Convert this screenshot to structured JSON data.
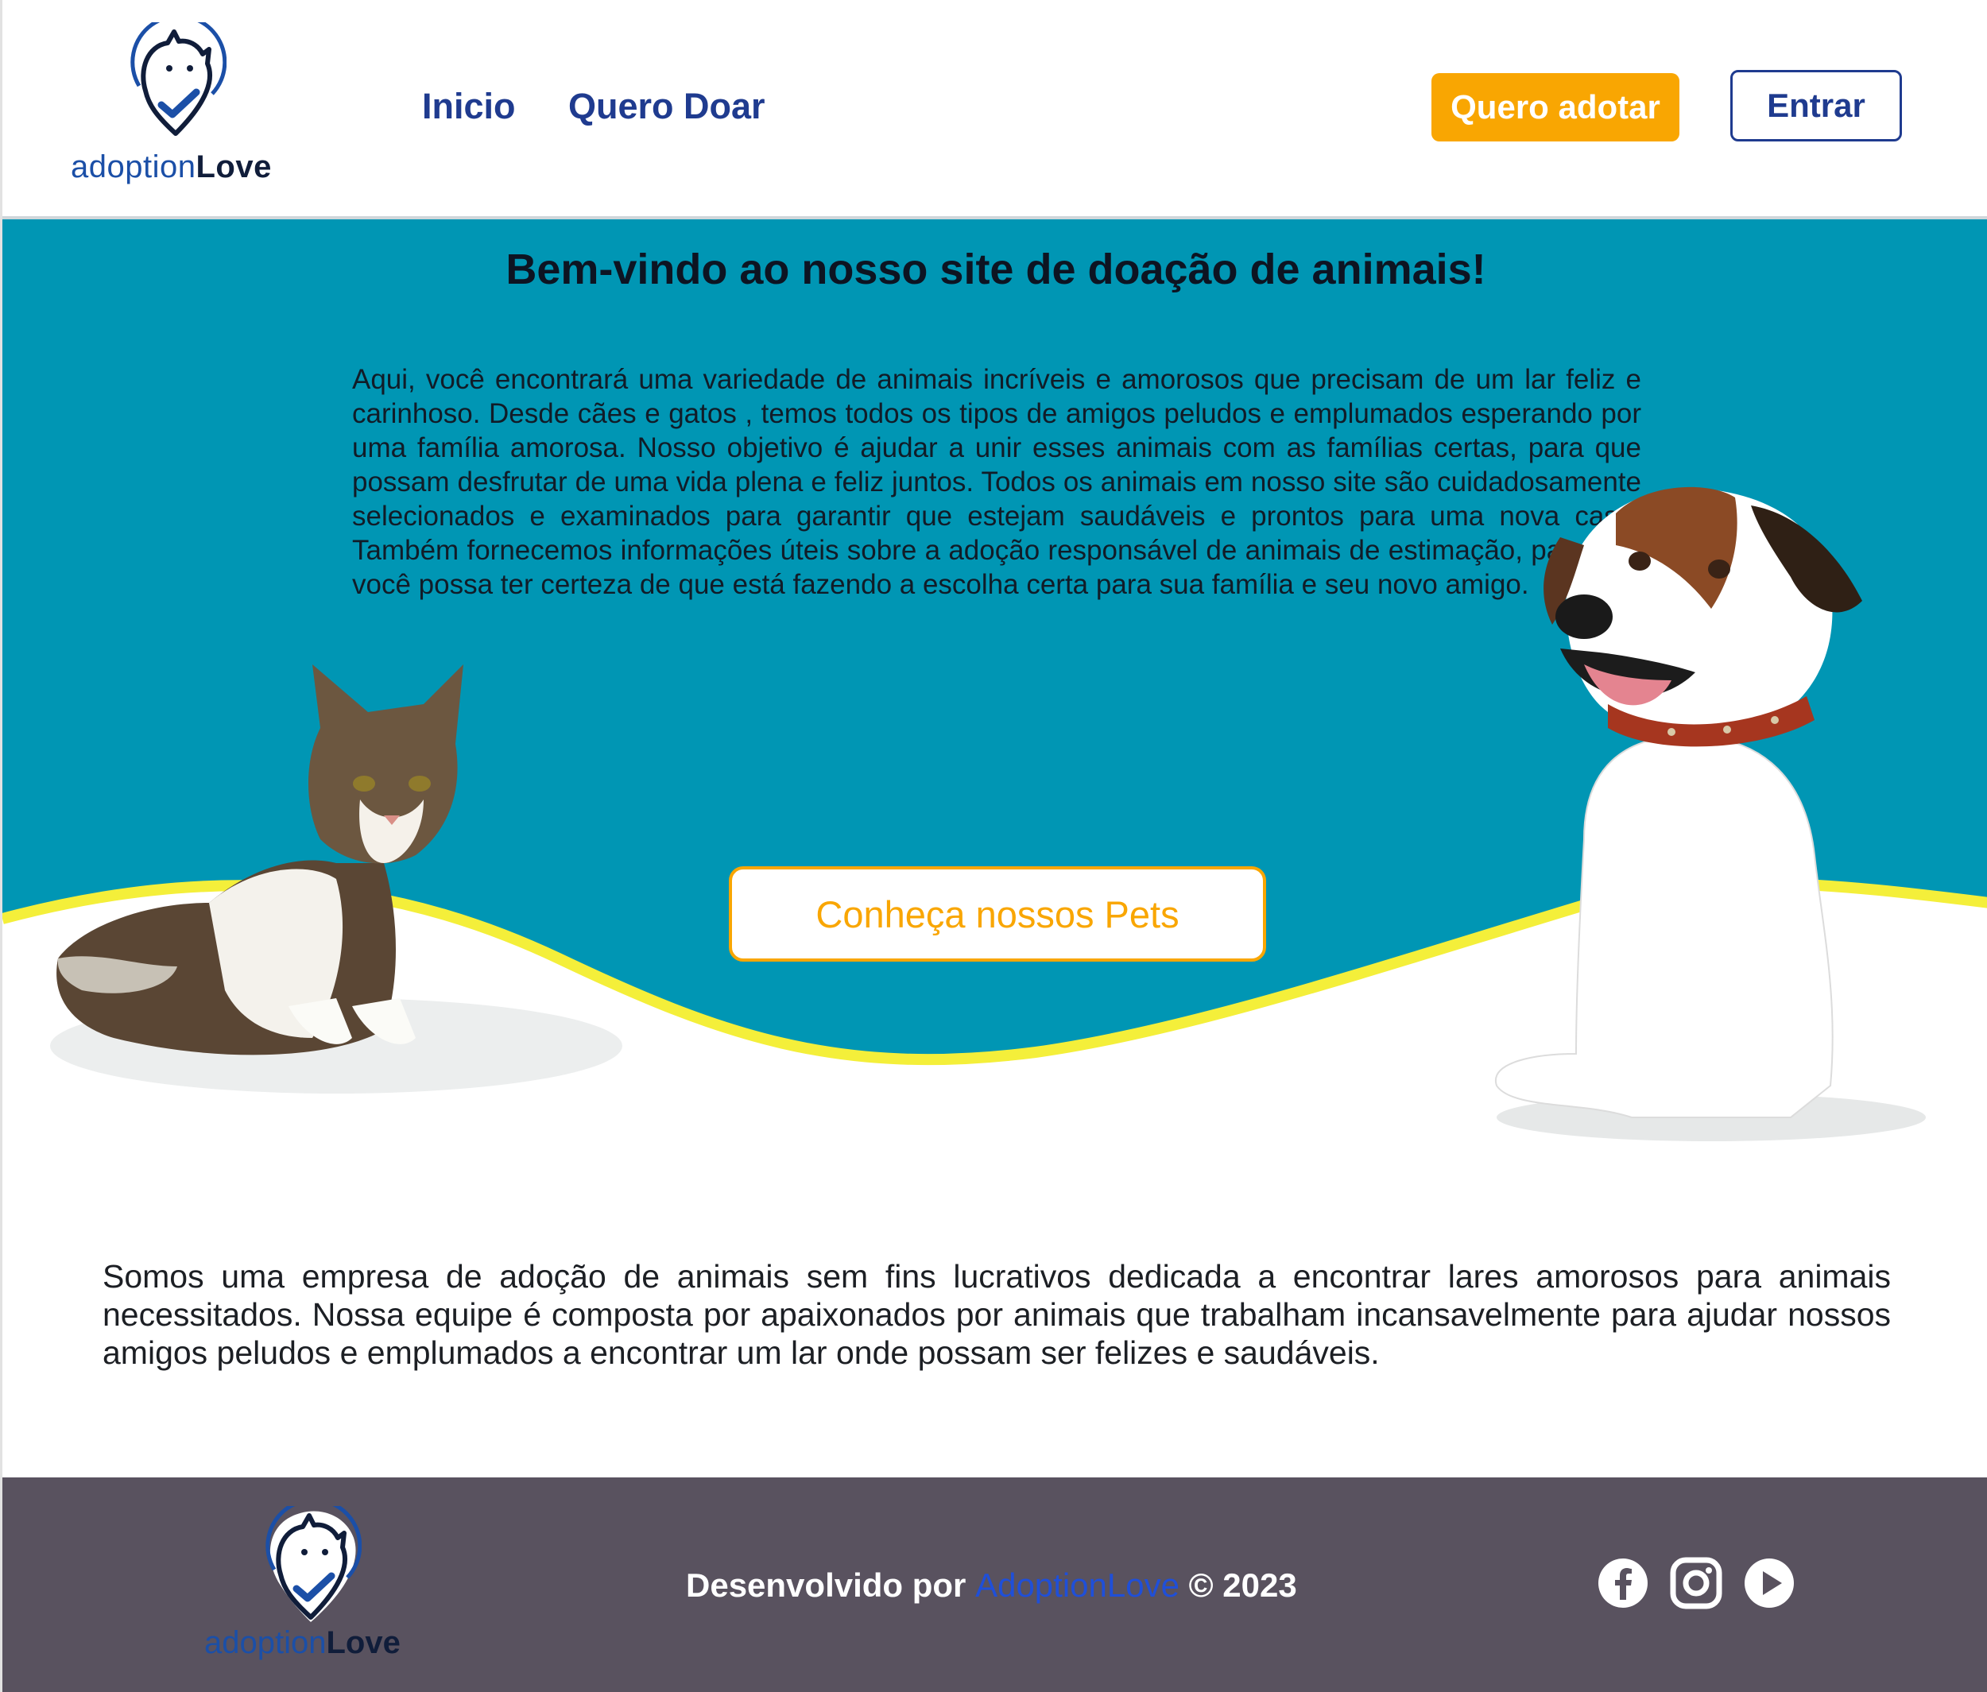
{
  "header": {
    "logo": {
      "part1": "adoption",
      "part2": "Love"
    },
    "nav": [
      {
        "label": "Inicio"
      },
      {
        "label": "Quero Doar"
      }
    ],
    "adopt_button": "Quero adotar",
    "login_button": "Entrar"
  },
  "hero": {
    "title": "Bem-vindo ao nosso site de doação de animais!",
    "text": "Aqui, você encontrará uma variedade de animais incríveis e amorosos que precisam de um lar feliz e carinhoso. Desde cães e gatos , temos todos os tipos de amigos peludos e emplumados esperando por uma família amorosa. Nosso objetivo é ajudar a unir esses animais com as famílias certas, para que possam desfrutar de uma vida plena e feliz juntos. Todos os animais em nosso site são cuidadosamente selecionados e examinados para garantir que estejam saudáveis e prontos para uma nova casa. Também fornecemos informações úteis sobre a adoção responsável de animais de estimação, para que você possa ter certeza de que está fazendo a escolha certa para sua família e seu novo amigo.",
    "cta": "Conheça nossos Pets"
  },
  "about": {
    "text": "Somos uma empresa de adoção de animais sem fins lucrativos dedicada a encontrar lares amorosos para animais necessitados. Nossa equipe é composta por apaixonados por animais que trabalham incansavelmente para ajudar nossos amigos peludos e emplumados a encontrar um lar onde possam ser felizes e saudáveis."
  },
  "footer": {
    "logo": {
      "part1": "adoption",
      "part2": "Love"
    },
    "credits_prefix": "Desenvolvido por ",
    "credits_brand": "AdoptionLove",
    "credits_suffix": " © 2023",
    "socials": [
      "facebook-icon",
      "instagram-icon",
      "youtube-icon"
    ]
  },
  "colors": {
    "primary_blue": "#1f3b8f",
    "orange": "#f9a602",
    "teal": "#0096b4",
    "wave_yellow": "#f4ef3a",
    "footer_bg": "#59525f"
  }
}
